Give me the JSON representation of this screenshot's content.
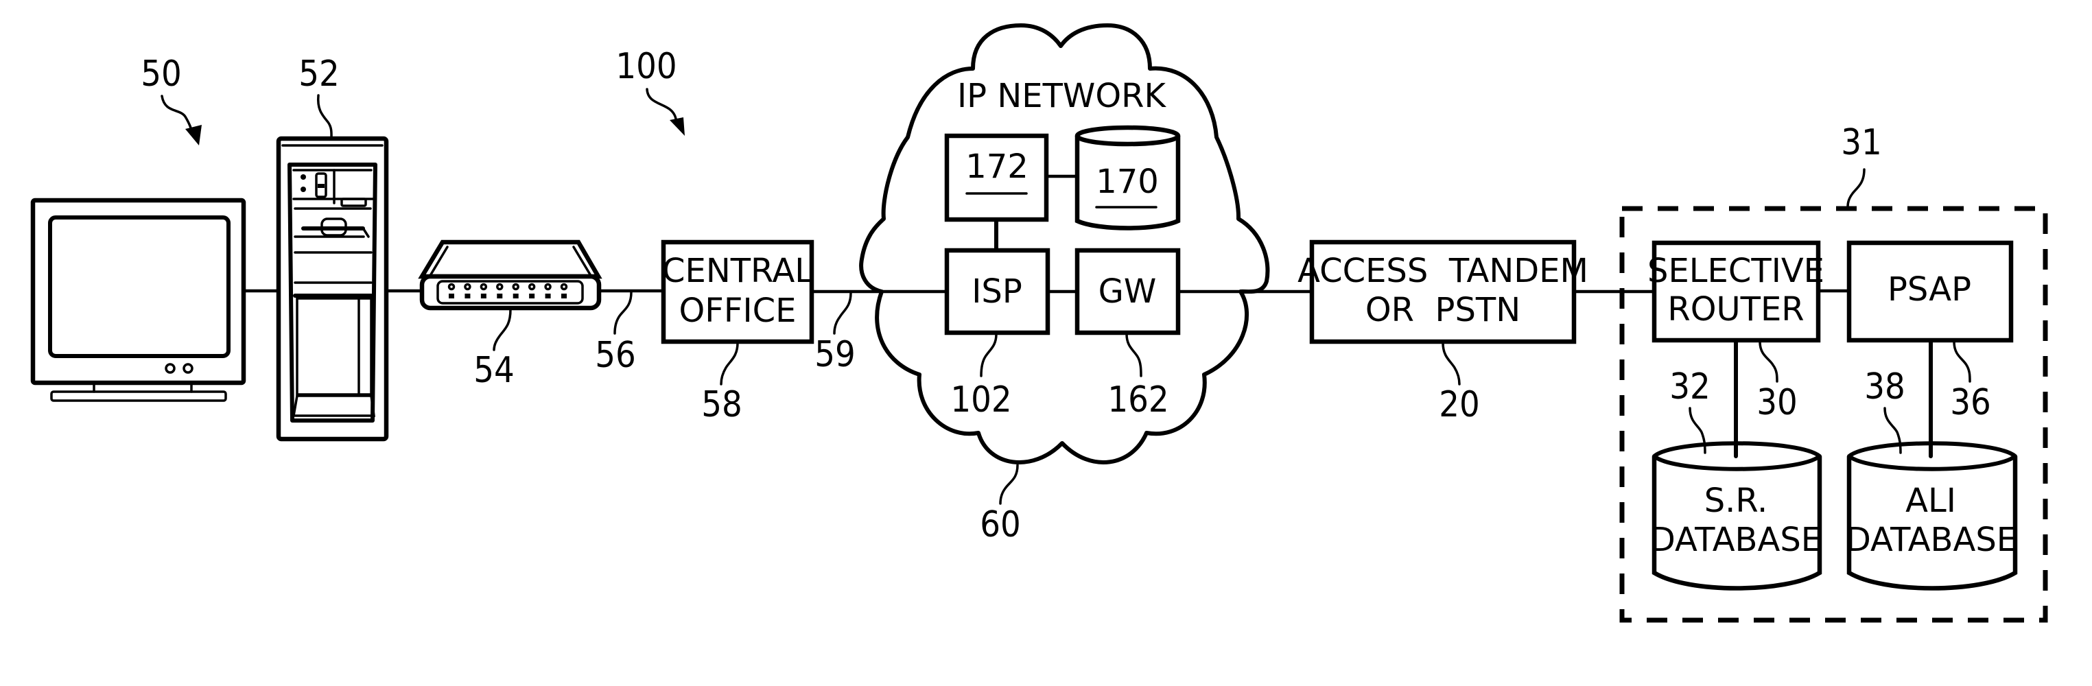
{
  "figure": {
    "type": "network block diagram",
    "colors": {
      "ink": "#000000",
      "background": "#ffffff"
    }
  },
  "devices": {
    "computer": {
      "ref": "50",
      "icon": "computer-monitor-icon"
    },
    "tower": {
      "ref": "52",
      "icon": "desktop-tower-icon"
    },
    "modem": {
      "ref": "54",
      "icon": "modem-icon",
      "led_count": 8
    },
    "system": {
      "ref": "100"
    }
  },
  "links": {
    "modem_to_co": {
      "ref": "56"
    },
    "co_to_network": {
      "ref": "59"
    }
  },
  "central_office": {
    "ref": "58",
    "line1": "CENTRAL",
    "line2": "OFFICE"
  },
  "ip_network": {
    "ref": "60",
    "title": "IP NETWORK",
    "server": {
      "ref": "172",
      "label": "172"
    },
    "database": {
      "ref": "170",
      "label": "170"
    },
    "isp": {
      "ref": "102",
      "label": "ISP"
    },
    "gateway": {
      "ref": "162",
      "label": "GW"
    }
  },
  "access_tandem": {
    "ref": "20",
    "line1": "ACCESS  TANDEM",
    "line2": "OR  PSTN"
  },
  "emergency_system": {
    "ref": "31",
    "selective_router": {
      "ref": "30",
      "line1": "SELECTIVE",
      "line2": "ROUTER"
    },
    "psap": {
      "ref": "36",
      "label": "PSAP"
    },
    "sr_database": {
      "ref": "32",
      "line1": "S.R.",
      "line2": "DATABASE"
    },
    "ali_database": {
      "ref": "38",
      "line1": "ALI",
      "line2": "DATABASE"
    }
  }
}
